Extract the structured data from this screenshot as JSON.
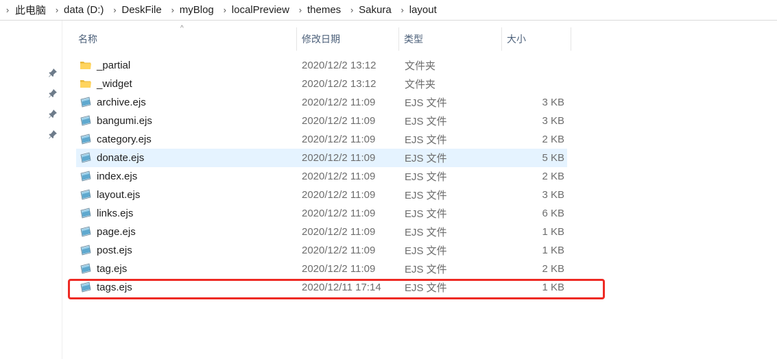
{
  "breadcrumb": [
    "此电脑",
    "data (D:)",
    "DeskFile",
    "myBlog",
    "localPreview",
    "themes",
    "Sakura",
    "layout"
  ],
  "columns": {
    "name": "名称",
    "date": "修改日期",
    "type": "类型",
    "size": "大小"
  },
  "files": [
    {
      "name": "_partial",
      "date": "2020/12/2 13:12",
      "type": "文件夹",
      "size": "",
      "kind": "folder"
    },
    {
      "name": "_widget",
      "date": "2020/12/2 13:12",
      "type": "文件夹",
      "size": "",
      "kind": "folder"
    },
    {
      "name": "archive.ejs",
      "date": "2020/12/2 11:09",
      "type": "EJS 文件",
      "size": "3 KB",
      "kind": "file"
    },
    {
      "name": "bangumi.ejs",
      "date": "2020/12/2 11:09",
      "type": "EJS 文件",
      "size": "3 KB",
      "kind": "file"
    },
    {
      "name": "category.ejs",
      "date": "2020/12/2 11:09",
      "type": "EJS 文件",
      "size": "2 KB",
      "kind": "file"
    },
    {
      "name": "donate.ejs",
      "date": "2020/12/2 11:09",
      "type": "EJS 文件",
      "size": "5 KB",
      "kind": "file"
    },
    {
      "name": "index.ejs",
      "date": "2020/12/2 11:09",
      "type": "EJS 文件",
      "size": "2 KB",
      "kind": "file"
    },
    {
      "name": "layout.ejs",
      "date": "2020/12/2 11:09",
      "type": "EJS 文件",
      "size": "3 KB",
      "kind": "file"
    },
    {
      "name": "links.ejs",
      "date": "2020/12/2 11:09",
      "type": "EJS 文件",
      "size": "6 KB",
      "kind": "file"
    },
    {
      "name": "page.ejs",
      "date": "2020/12/2 11:09",
      "type": "EJS 文件",
      "size": "1 KB",
      "kind": "file"
    },
    {
      "name": "post.ejs",
      "date": "2020/12/2 11:09",
      "type": "EJS 文件",
      "size": "1 KB",
      "kind": "file"
    },
    {
      "name": "tag.ejs",
      "date": "2020/12/2 11:09",
      "type": "EJS 文件",
      "size": "2 KB",
      "kind": "file"
    },
    {
      "name": "tags.ejs",
      "date": "2020/12/11 17:14",
      "type": "EJS 文件",
      "size": "1 KB",
      "kind": "file"
    }
  ],
  "selected_file": "donate.ejs",
  "highlighted_file": "tags.ejs",
  "colors": {
    "selection": "#e5f3ff",
    "highlight_border": "#ee2a24",
    "header_text": "#4c607a"
  }
}
